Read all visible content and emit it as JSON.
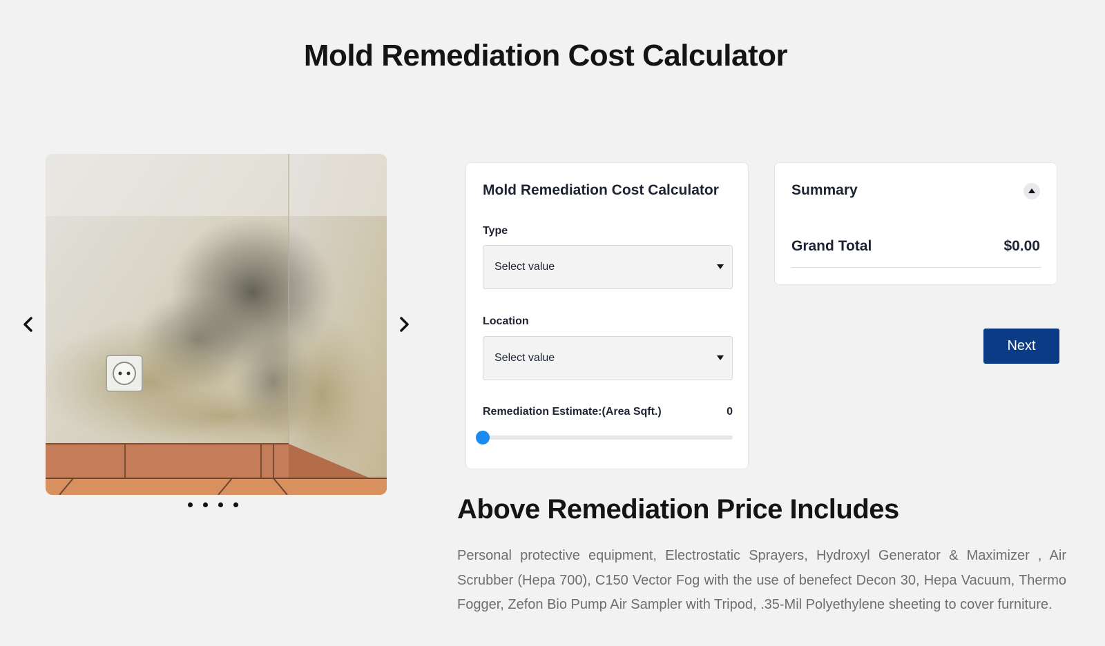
{
  "page": {
    "title": "Mold Remediation Cost Calculator"
  },
  "slider": {
    "prev_icon": "chevron-left-icon",
    "next_icon": "chevron-right-icon",
    "image": "moldy-wall-corner-with-outlet",
    "dot_count": 4
  },
  "calculator": {
    "title": "Mold Remediation Cost Calculator",
    "type_label": "Type",
    "type_value": "Select value",
    "location_label": "Location",
    "location_value": "Select value",
    "range_label": "Remediation Estimate:(Area Sqft.)",
    "range_value": "0",
    "range_fraction": 0,
    "accent_color": "#1a8cf0"
  },
  "summary": {
    "title": "Summary",
    "collapse_icon": "caret-up-icon",
    "total_label": "Grand Total",
    "total_value": "$0.00"
  },
  "next_button": {
    "label": "Next",
    "color": "#0c3b85"
  },
  "includes": {
    "heading": "Above Remediation Price Includes",
    "body": "Personal protective equipment, Electrostatic Sprayers, Hydroxyl Generator & Maximizer , Air Scrubber (Hepa 700), C150 Vector Fog with the use of benefect Decon 30, Hepa Vacuum, Thermo Fogger, Zefon Bio Pump Air Sampler with Tripod, .35-Mil Polyethylene sheeting to cover furniture."
  }
}
